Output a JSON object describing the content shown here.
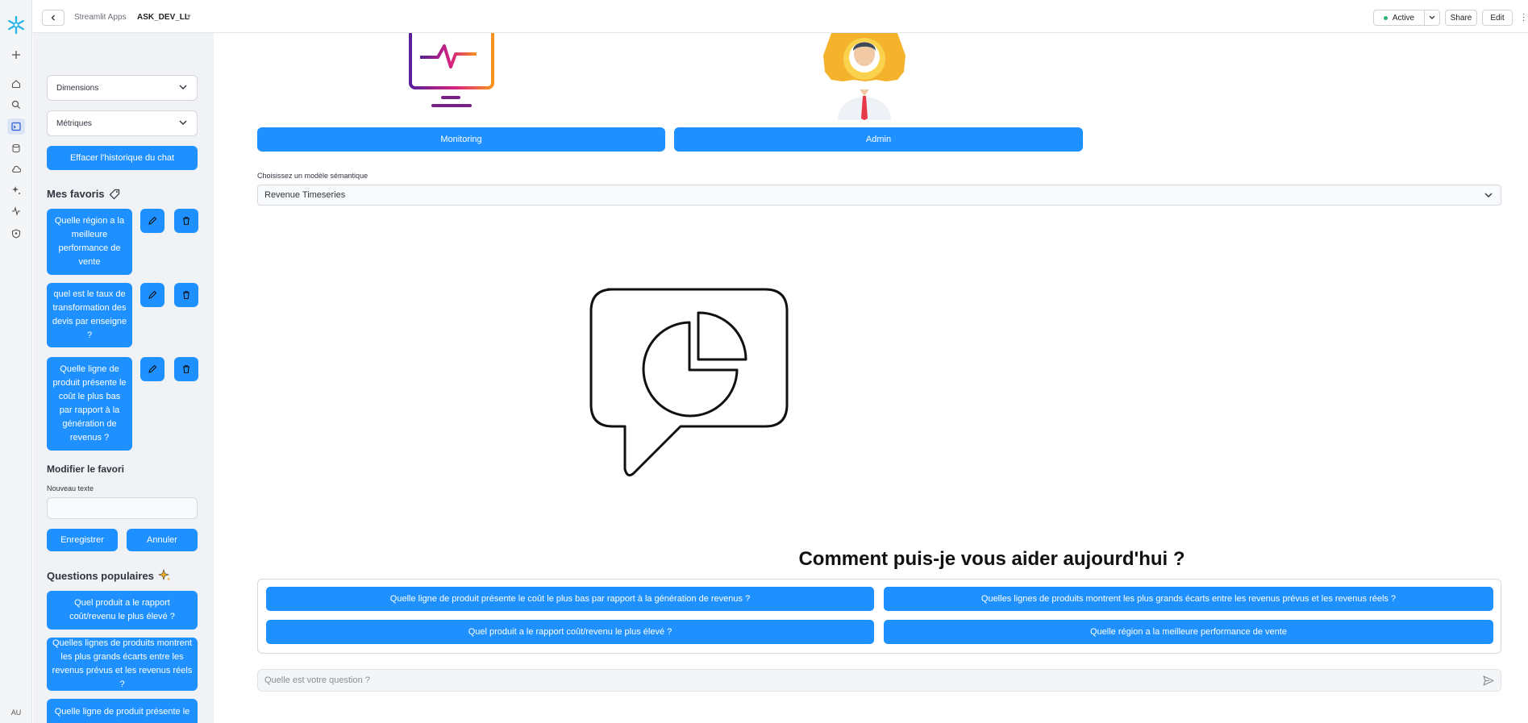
{
  "topbar": {
    "breadcrumb_app": "Streamlit Apps",
    "breadcrumb_name": "ASK_DEV_LL",
    "status": "Active",
    "share": "Share",
    "edit": "Edit"
  },
  "rail": {
    "user_initials": "AU"
  },
  "sidebar": {
    "dimensions": "Dimensions",
    "metriques": "Métriques",
    "clear_history": "Effacer l'historique du chat",
    "favorites_title": "Mes favoris",
    "favorites": [
      "Quelle région a la meilleure performance de vente",
      "quel est le taux de transformation des devis par enseigne ?",
      "Quelle ligne de produit présente le coût le plus bas par rapport à la génération de revenus ?"
    ],
    "edit_title": "Modifier le favori",
    "new_text_label": "Nouveau texte",
    "new_text_value": "",
    "save": "Enregistrer",
    "cancel": "Annuler",
    "popular_title": "Questions populaires",
    "popular": [
      "Quel produit a le rapport coût/revenu le plus élevé ?",
      "Quelles lignes de produits montrent les plus grands écarts entre les revenus prévus et les revenus réels ?",
      "Quelle ligne de produit présente le"
    ]
  },
  "main": {
    "monitoring": "Monitoring",
    "admin": "Admin",
    "model_label": "Choisissez un modèle sémantique",
    "model_value": "Revenue Timeseries",
    "heading": "Comment puis-je vous aider aujourd'hui ?",
    "suggestions": [
      "Quelle ligne de produit présente le coût le plus bas par rapport à la génération de revenus ?",
      "Quelles lignes de produits montrent les plus grands écarts entre les revenus prévus et les revenus réels ?",
      "Quel produit a le rapport coût/revenu le plus élevé ?",
      "Quelle région a la meilleure performance de vente"
    ],
    "chat_placeholder": "Quelle est votre question ?"
  },
  "colors": {
    "accent": "#1e90ff",
    "sidebar_bg": "#f0f2f6"
  }
}
